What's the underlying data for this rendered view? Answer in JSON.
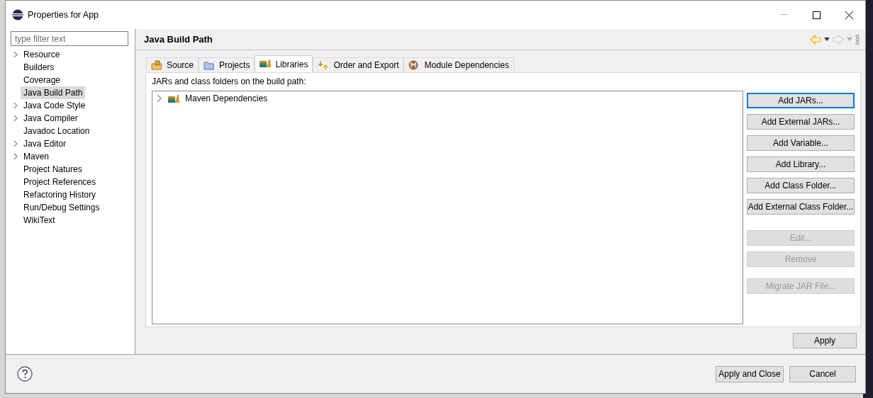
{
  "window": {
    "title": "Properties for App"
  },
  "filter": {
    "placeholder": "type filter text"
  },
  "tree": [
    {
      "label": "Resource",
      "kind": "group",
      "selected": false
    },
    {
      "label": "Builders",
      "kind": "leaf",
      "selected": false
    },
    {
      "label": "Coverage",
      "kind": "leaf",
      "selected": false
    },
    {
      "label": "Java Build Path",
      "kind": "leaf",
      "selected": true
    },
    {
      "label": "Java Code Style",
      "kind": "group",
      "selected": false
    },
    {
      "label": "Java Compiler",
      "kind": "group",
      "selected": false
    },
    {
      "label": "Javadoc Location",
      "kind": "leaf",
      "selected": false
    },
    {
      "label": "Java Editor",
      "kind": "group",
      "selected": false
    },
    {
      "label": "Maven",
      "kind": "group",
      "selected": false
    },
    {
      "label": "Project Natures",
      "kind": "leaf",
      "selected": false
    },
    {
      "label": "Project References",
      "kind": "leaf",
      "selected": false
    },
    {
      "label": "Refactoring History",
      "kind": "leaf",
      "selected": false
    },
    {
      "label": "Run/Debug Settings",
      "kind": "leaf",
      "selected": false
    },
    {
      "label": "WikiText",
      "kind": "leaf",
      "selected": false
    }
  ],
  "page": {
    "title": "Java Build Path",
    "back_disabled": false,
    "forward_disabled": true
  },
  "tabs": [
    {
      "label": "Source",
      "selected": false
    },
    {
      "label": "Projects",
      "selected": false
    },
    {
      "label": "Libraries",
      "selected": true
    },
    {
      "label": "Order and Export",
      "selected": false
    },
    {
      "label": "Module Dependencies",
      "selected": false
    }
  ],
  "list_caption": "JARs and class folders on the build path:",
  "entries": [
    {
      "label": "Maven Dependencies",
      "expanded": false
    }
  ],
  "button_groups": [
    [
      {
        "label": "Add JARs...",
        "disabled": false,
        "focused": true
      },
      {
        "label": "Add External JARs...",
        "disabled": false,
        "focused": false
      },
      {
        "label": "Add Variable...",
        "disabled": false,
        "focused": false
      },
      {
        "label": "Add Library...",
        "disabled": false,
        "focused": false
      },
      {
        "label": "Add Class Folder...",
        "disabled": false,
        "focused": false
      },
      {
        "label": "Add External Class Folder...",
        "disabled": false,
        "focused": false
      }
    ],
    [
      {
        "label": "Edit...",
        "disabled": true,
        "focused": false
      },
      {
        "label": "Remove",
        "disabled": true,
        "focused": false
      }
    ],
    [
      {
        "label": "Migrate JAR File...",
        "disabled": true,
        "focused": false
      }
    ]
  ],
  "apply_button": "Apply",
  "footer_buttons": [
    "Apply and Close",
    "Cancel"
  ]
}
